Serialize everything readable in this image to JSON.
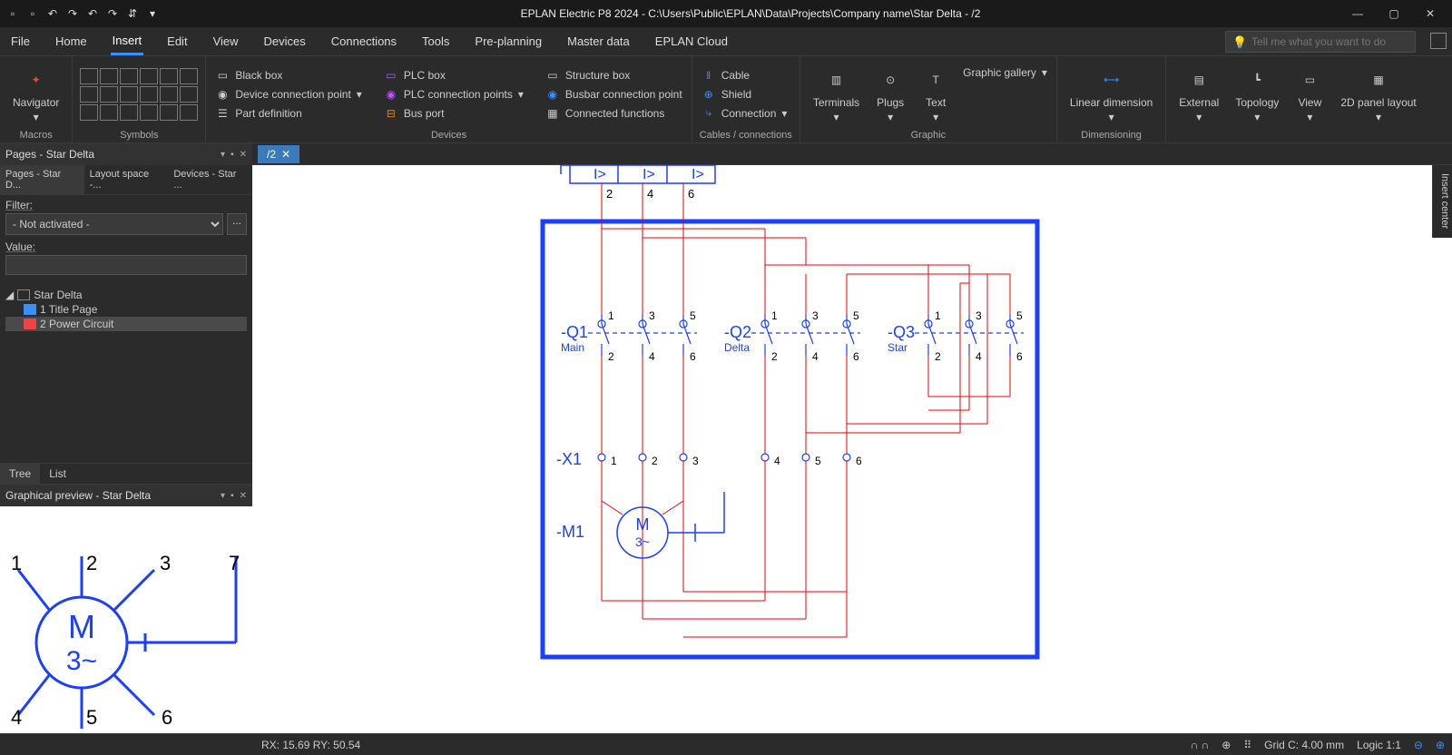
{
  "title": "EPLAN Electric P8 2024 - C:\\Users\\Public\\EPLAN\\Data\\Projects\\Company name\\Star Delta - /2",
  "menu": {
    "tabs": [
      "File",
      "Home",
      "Insert",
      "Edit",
      "View",
      "Devices",
      "Connections",
      "Tools",
      "Pre-planning",
      "Master data",
      "EPLAN Cloud"
    ],
    "active": "Insert",
    "search_placeholder": "Tell me what you want to do"
  },
  "ribbon": {
    "groups": {
      "macros": {
        "label": "Macros",
        "navigator": "Navigator"
      },
      "symbols": {
        "label": "Symbols"
      },
      "devices": {
        "label": "Devices",
        "col1": [
          "Black box",
          "Device connection point",
          "Part definition"
        ],
        "col2": [
          "PLC box",
          "PLC connection points",
          "Bus port"
        ],
        "col3": [
          "Structure box",
          "Busbar connection point",
          "Connected functions"
        ]
      },
      "cables": {
        "label": "Cables / connections",
        "items": [
          "Cable",
          "Shield",
          "Connection"
        ]
      },
      "graphic": {
        "label": "Graphic",
        "terminals": "Terminals",
        "plugs": "Plugs",
        "text": "Text",
        "gallery": "Graphic gallery"
      },
      "dimensioning": {
        "label": "Dimensioning",
        "linear": "Linear dimension"
      },
      "others": {
        "external": "External",
        "topology": "Topology",
        "view": "View",
        "panel": "2D panel layout"
      }
    }
  },
  "pages_panel": {
    "title": "Pages - Star Delta",
    "subtabs": [
      "Pages - Star D...",
      "Layout space -...",
      "Devices - Star ..."
    ],
    "filter_label": "Filter:",
    "filter_value": "- Not activated -",
    "value_label": "Value:",
    "tree": {
      "root": "Star Delta",
      "items": [
        "1 Title Page",
        "2 Power Circuit"
      ],
      "selected": "2 Power Circuit"
    },
    "bottomtabs": [
      "Tree",
      "List"
    ]
  },
  "preview_panel": {
    "title": "Graphical preview - Star Delta"
  },
  "doc_tab": "/2",
  "insert_center": "Insert center",
  "schematic": {
    "overload": {
      "labels": [
        "I>",
        "I>",
        "I>"
      ],
      "terms": [
        "2",
        "4",
        "6"
      ]
    },
    "contactors": [
      {
        "dt": "-Q1",
        "sub": "Main",
        "top": [
          "1",
          "3",
          "5"
        ],
        "bot": [
          "2",
          "4",
          "6"
        ]
      },
      {
        "dt": "-Q2",
        "sub": "Delta",
        "top": [
          "1",
          "3",
          "5"
        ],
        "bot": [
          "2",
          "4",
          "6"
        ]
      },
      {
        "dt": "-Q3",
        "sub": "Star",
        "top": [
          "1",
          "3",
          "5"
        ],
        "bot": [
          "2",
          "4",
          "6"
        ]
      }
    ],
    "x1": {
      "dt": "-X1",
      "terms": [
        "1",
        "2",
        "3",
        "4",
        "5",
        "6"
      ]
    },
    "motor": {
      "dt": "-M1",
      "label1": "M",
      "label2": "3~"
    },
    "preview_terms": [
      "1",
      "2",
      "3",
      "7",
      "4",
      "5",
      "6"
    ]
  },
  "statusbar": {
    "coords": "RX: 15.69 RY: 50.54",
    "grid": "Grid C: 4.00 mm",
    "logic": "Logic 1:1"
  }
}
